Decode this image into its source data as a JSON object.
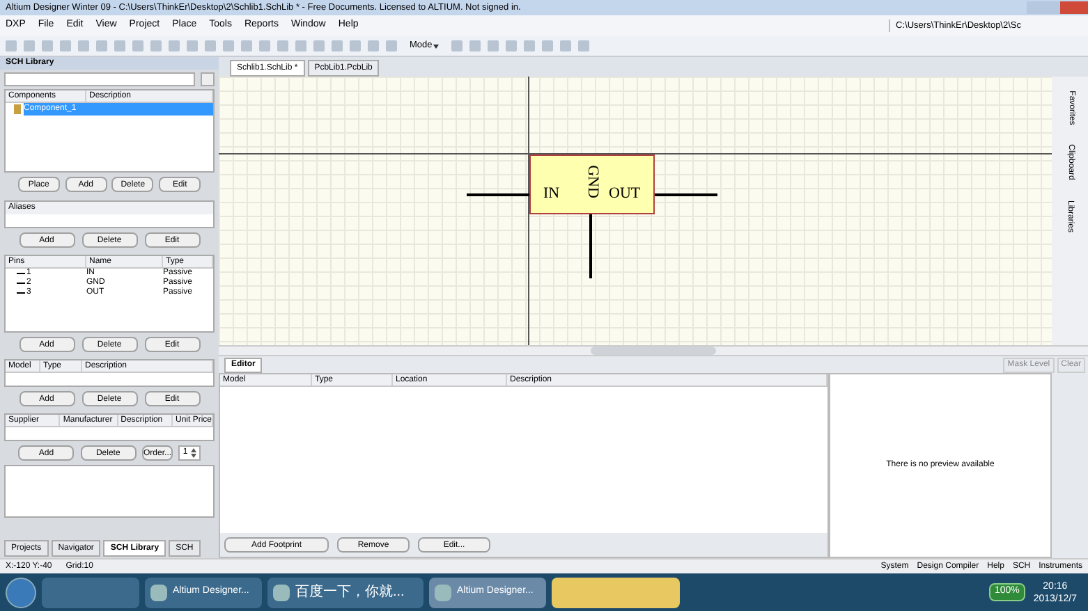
{
  "window": {
    "title": "Altium Designer Winter 09 - C:\\Users\\ThinkEr\\Desktop\\2\\Schlib1.SchLib * - Free Documents. Licensed to ALTIUM. Not signed in."
  },
  "menu": {
    "items": [
      "DXP",
      "File",
      "Edit",
      "View",
      "Project",
      "Place",
      "Tools",
      "Reports",
      "Window",
      "Help"
    ],
    "path": "C:\\Users\\ThinkEr\\Desktop\\2\\Sc"
  },
  "toolbar": {
    "mode": "Mode"
  },
  "sch_library": {
    "title": "SCH Library",
    "components": {
      "columns": [
        "Components",
        "Description"
      ],
      "rows": [
        {
          "name": "Component_1",
          "selected": true
        }
      ],
      "buttons": [
        "Place",
        "Add",
        "Delete",
        "Edit"
      ]
    },
    "aliases": {
      "title": "Aliases",
      "buttons": [
        "Add",
        "Delete",
        "Edit"
      ]
    },
    "pins": {
      "columns": [
        "Pins",
        "Name",
        "Type"
      ],
      "rows": [
        {
          "pin": "1",
          "name": "IN",
          "type": "Passive"
        },
        {
          "pin": "2",
          "name": "GND",
          "type": "Passive"
        },
        {
          "pin": "3",
          "name": "OUT",
          "type": "Passive"
        }
      ],
      "buttons": [
        "Add",
        "Delete",
        "Edit"
      ]
    },
    "models": {
      "columns": [
        "Model",
        "Type",
        "Description"
      ],
      "buttons": [
        "Add",
        "Delete",
        "Edit"
      ]
    },
    "suppliers": {
      "columns": [
        "Supplier",
        "Manufacturer",
        "Description",
        "Unit Price"
      ],
      "buttons": [
        "Add",
        "Delete",
        "Order..."
      ],
      "order_qty": "1"
    },
    "tabs": [
      {
        "label": "Projects",
        "selected": false
      },
      {
        "label": "Navigator",
        "selected": false
      },
      {
        "label": "SCH Library",
        "selected": true
      },
      {
        "label": "SCH",
        "selected": false
      }
    ]
  },
  "documents": {
    "tabs": [
      {
        "label": "Schlib1.SchLib *",
        "selected": true
      },
      {
        "label": "PcbLib1.PcbLib",
        "selected": false
      }
    ]
  },
  "schematic": {
    "component": {
      "pins": [
        "IN",
        "GND",
        "OUT"
      ]
    }
  },
  "side_panels": [
    "Favorites",
    "Clipboard",
    "Libraries"
  ],
  "editor": {
    "tab": "Editor",
    "mask_buttons": [
      "Mask Level",
      "Clear"
    ],
    "columns": [
      "Model",
      "Type",
      "Location",
      "Description"
    ],
    "preview": "There is no preview available",
    "buttons": [
      "Add Footprint",
      "Remove",
      "Edit..."
    ]
  },
  "status_bar": {
    "coords": "X:-120 Y:-40",
    "grid": "Grid:10",
    "panels": [
      "System",
      "Design Compiler",
      "Help",
      "SCH",
      "Instruments"
    ]
  },
  "taskbar": {
    "items": [
      {
        "label": "Altium Designer...",
        "active": false
      },
      {
        "label": "百度一下，你就...",
        "active": false
      },
      {
        "label": "Altium Designer...",
        "active": true
      }
    ],
    "battery": "100%",
    "time": "20:16",
    "date": "2013/12/7"
  }
}
